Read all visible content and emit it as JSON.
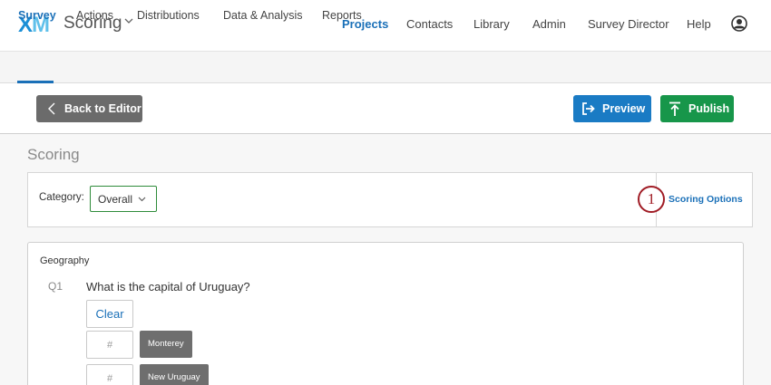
{
  "header": {
    "logo": {
      "x": "X",
      "m": "M"
    },
    "project_name": "Scoring",
    "nav": [
      "Projects",
      "Contacts",
      "Library",
      "Admin",
      "Survey Director",
      "Help"
    ],
    "active_nav": "Projects",
    "user_icon": "user-circle-icon"
  },
  "tabs": [
    "Survey",
    "Actions",
    "Distributions",
    "Data & Analysis",
    "Reports"
  ],
  "active_tab": "Survey",
  "actionbar": {
    "back_label": "Back to Editor",
    "preview_label": "Preview",
    "publish_label": "Publish"
  },
  "page": {
    "title": "Scoring",
    "category_label": "Category:",
    "category_value": "Overall",
    "scoring_options": "Scoring Options",
    "callout_number": "1"
  },
  "block": {
    "title": "Geography",
    "question": {
      "number": "Q1",
      "text": "What is the capital of Uruguay?",
      "clear_label": "Clear",
      "choices": [
        {
          "label": "Monterey",
          "placeholder": "#"
        },
        {
          "label": "New Uruguay",
          "placeholder": "#"
        }
      ]
    }
  },
  "colors": {
    "brand_blue": "#1a70b8",
    "preview_blue": "#1a7bc4",
    "publish_green": "#17964a",
    "callout_red": "#a01c25",
    "select_border_green": "#2e8b3a"
  }
}
